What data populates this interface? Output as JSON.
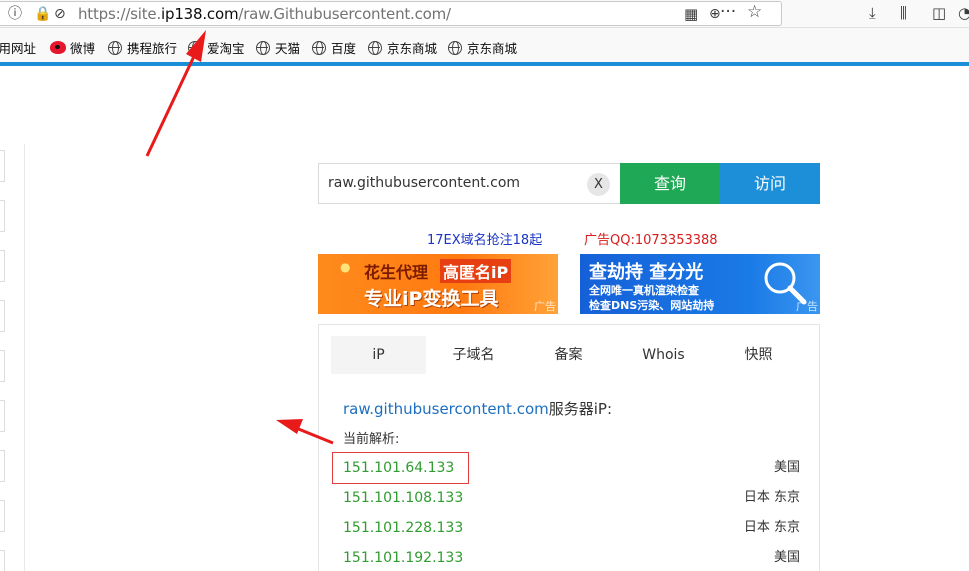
{
  "browser": {
    "url_prefix": "https://site.",
    "url_host": "ip138.com",
    "url_path": "/raw.Githubusercontent.com/"
  },
  "bookmarks": [
    {
      "label": "常用网址",
      "icon": "partial"
    },
    {
      "label": "微博",
      "icon": "weibo-icon"
    },
    {
      "label": "携程旅行",
      "icon": "globe-icon"
    },
    {
      "label": "爱淘宝",
      "icon": "globe-icon"
    },
    {
      "label": "天猫",
      "icon": "globe-icon"
    },
    {
      "label": "百度",
      "icon": "globe-icon"
    },
    {
      "label": "京东商城",
      "icon": "globe-icon"
    },
    {
      "label": "京东商城",
      "icon": "globe-icon"
    }
  ],
  "search": {
    "value": "raw.githubusercontent.com",
    "clear_label": "X",
    "query_label": "查询",
    "visit_label": "访问"
  },
  "ads": {
    "link1": "17EX域名抢注18起",
    "link2": "广告QQ:1073353388",
    "banner_left": {
      "line1_a": "花生代理",
      "line1_b": "高匿名iP",
      "line2": "专业iP变换工具",
      "tag": "广告"
    },
    "banner_right": {
      "line1": "查劫持 查分光",
      "line2": "全网唯一真机渲染检查",
      "line3": "检查DNS污染、网站劫持",
      "tag": "广告"
    }
  },
  "tabs": [
    "iP",
    "子域名",
    "备案",
    "Whois",
    "快照"
  ],
  "results": {
    "domain": "raw.githubusercontent.com",
    "title_suffix": "服务器iP:",
    "label": "当前解析:",
    "rows": [
      {
        "ip": "151.101.64.133",
        "location": "美国"
      },
      {
        "ip": "151.101.108.133",
        "location": "日本 东京"
      },
      {
        "ip": "151.101.228.133",
        "location": "日本 东京"
      },
      {
        "ip": "151.101.192.133",
        "location": "美国"
      }
    ]
  },
  "colors": {
    "query_green": "#1fa855",
    "visit_blue": "#1c8fd8",
    "ip_green": "#2f9c2f",
    "annotation_red": "#e13b3b"
  }
}
